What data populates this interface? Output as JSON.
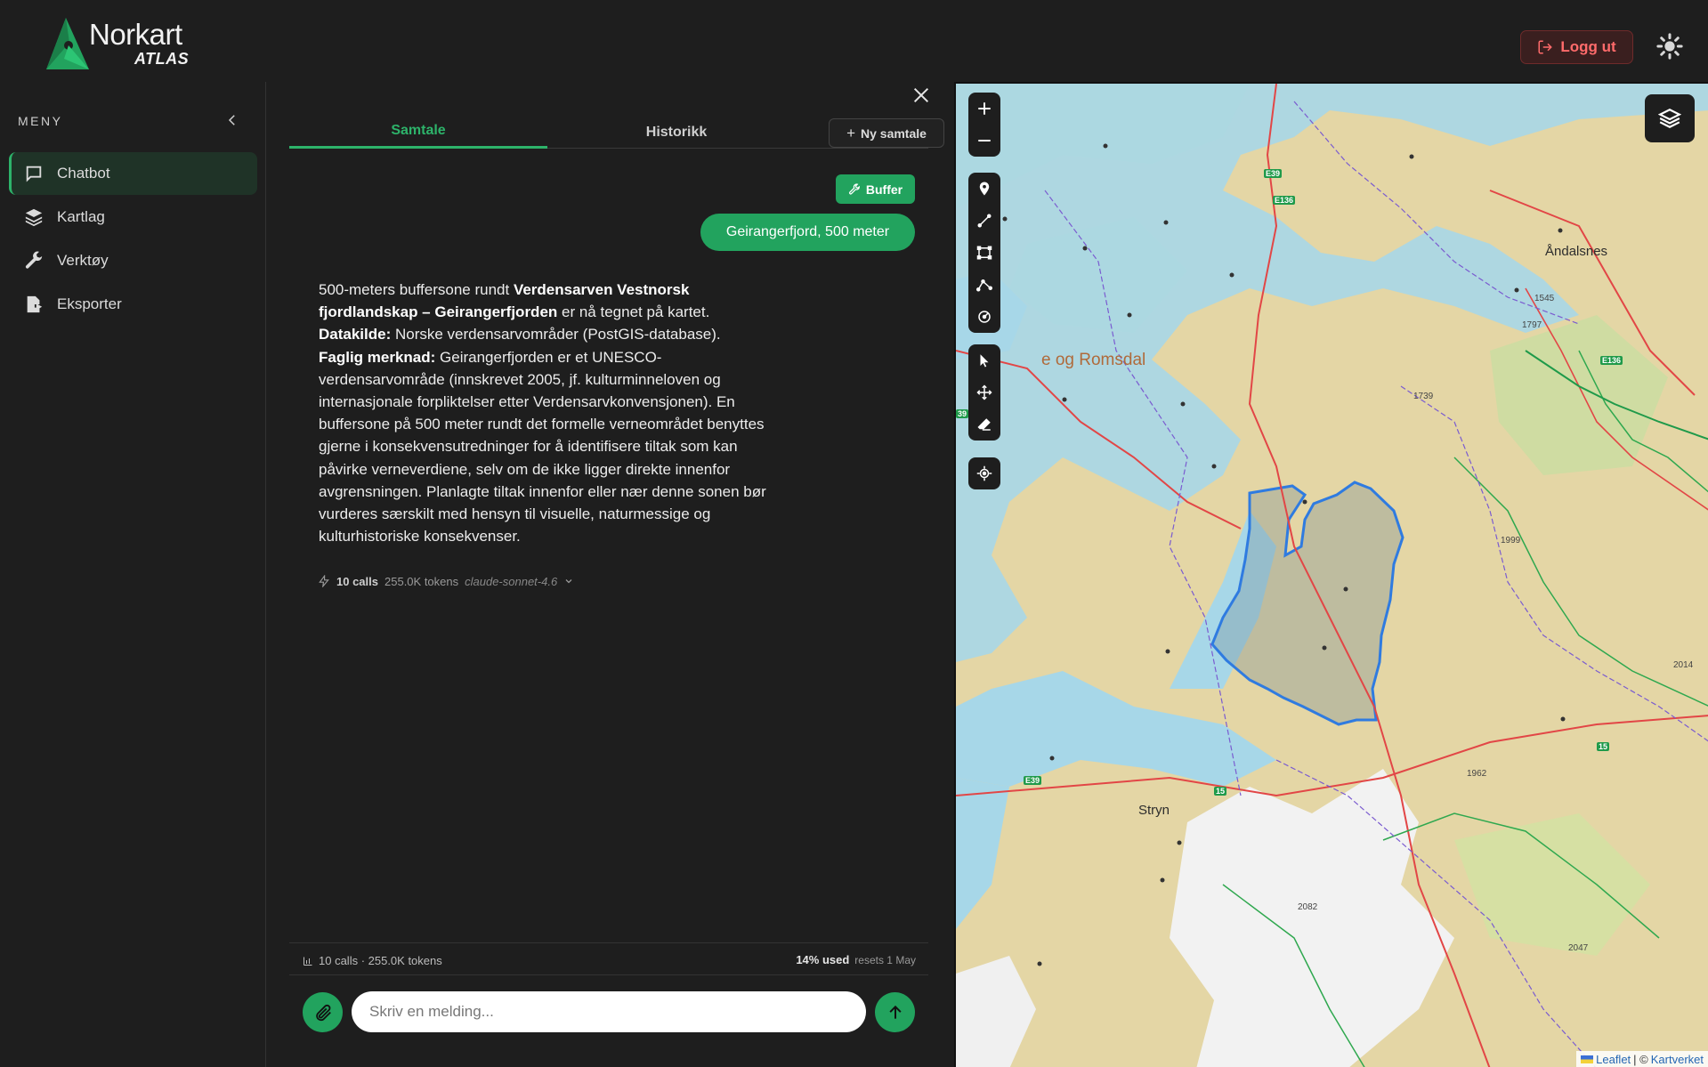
{
  "header": {
    "logo_title": "Norkart",
    "logo_subtitle": "ATLAS",
    "logout_label": "Logg ut"
  },
  "sidebar": {
    "menu_title": "MENY",
    "items": [
      {
        "label": "Chatbot",
        "icon": "chat-icon",
        "active": true
      },
      {
        "label": "Kartlag",
        "icon": "layers-icon",
        "active": false
      },
      {
        "label": "Verktøy",
        "icon": "wrench-icon",
        "active": false
      },
      {
        "label": "Eksporter",
        "icon": "export-icon",
        "active": false
      }
    ]
  },
  "chat": {
    "tabs": [
      {
        "label": "Samtale",
        "active": true
      },
      {
        "label": "Historikk",
        "active": false
      }
    ],
    "new_chat_label": "Ny samtale",
    "tool_chip_label": "Buffer",
    "user_message": "Geirangerfjord, 500 meter",
    "assistant": {
      "p1_pre": "500-meters buffersone rundt ",
      "p1_bold": "Verdensarven Vestnorsk fjordlandskap – Geirangerfjorden",
      "p1_post": " er nå tegnet på kartet.",
      "source_label": "Datakilde:",
      "source_text": " Norske verdensarvområder (PostGIS-database).",
      "note_label": "Faglig merknad:",
      "note_text": " Geirangerfjorden er et UNESCO-verdensarvområde (innskrevet 2005, jf. kulturminneloven og internasjonale forpliktelser etter Verdensarvkonvensjonen). En buffersone på 500 meter rundt det formelle verneområdet benyttes gjerne i konsekvensutredninger for å identifisere tiltak som kan påvirke verneverdiene, selv om de ikke ligger direkte innenfor avgrensningen. Planlagte tiltak innenfor eller nær denne sonen bør vurderes særskilt med hensyn til visuelle, naturmessige og kulturhistoriske konsekvenser."
    },
    "usage": {
      "calls": "10 calls",
      "tokens": "255.0K tokens",
      "model": "claude-sonnet-4.6"
    },
    "footer": {
      "summary": "10 calls · 255.0K tokens",
      "pct_used": "14% used",
      "reset": "resets 1 May"
    },
    "input_placeholder": "Skriv en melding..."
  },
  "map": {
    "labels": {
      "region": "e og Romsdal",
      "andalsnes": "Åndalsnes",
      "stryn": "Stryn"
    },
    "heights": [
      "1545",
      "1797",
      "1739",
      "1999",
      "2014",
      "1962",
      "2082",
      "2047"
    ],
    "roads": [
      "E39",
      "E136",
      "E136",
      "39",
      "E39",
      "15",
      "15"
    ],
    "attribution": {
      "leaflet": "Leaflet",
      "separator": "| ©",
      "kartverket": "Kartverket"
    }
  },
  "colors": {
    "accent": "#22a35e",
    "logout": "#ff6b6b",
    "buffer": "#2f7be0"
  }
}
